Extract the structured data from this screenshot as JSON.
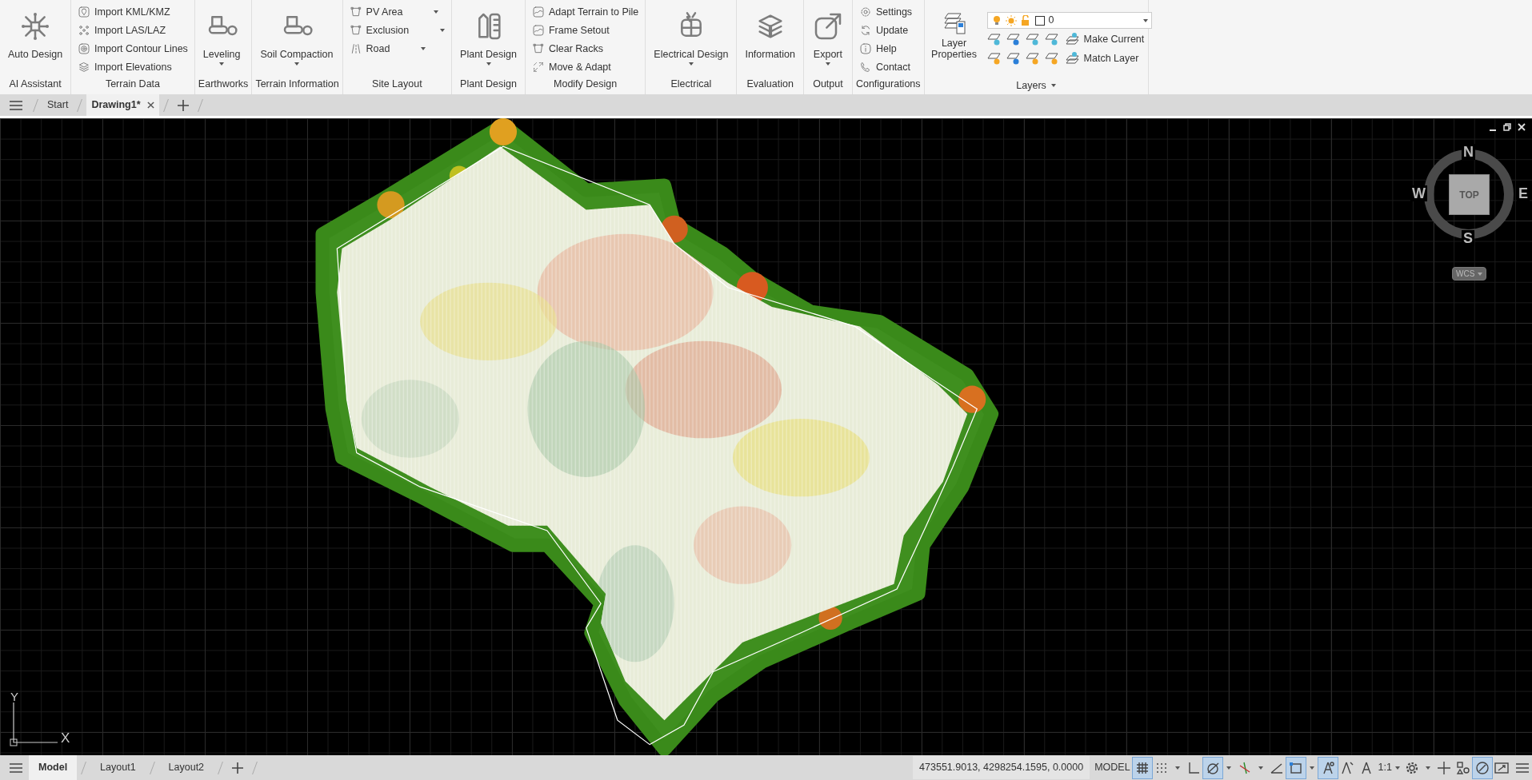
{
  "ribbon": {
    "panels": [
      {
        "label": "AI Assistant",
        "kind": "large",
        "items": [
          {
            "label": "Auto Design",
            "dropdown": false
          }
        ]
      },
      {
        "label": "Terrain Data",
        "kind": "list",
        "items": [
          {
            "label": "Import KML/KMZ",
            "dropdown": false
          },
          {
            "label": "Import LAS/LAZ",
            "dropdown": false
          },
          {
            "label": "Import Contour Lines",
            "dropdown": false
          },
          {
            "label": "Import Elevations",
            "dropdown": false
          }
        ]
      },
      {
        "label": "Earthworks",
        "kind": "large",
        "items": [
          {
            "label": "Leveling",
            "dropdown": true
          }
        ]
      },
      {
        "label": "Terrain Information",
        "kind": "large",
        "items": [
          {
            "label": "Soil Compaction",
            "dropdown": true
          }
        ]
      },
      {
        "label": "Site Layout",
        "kind": "list",
        "items": [
          {
            "label": "PV Area",
            "dropdown": true
          },
          {
            "label": "Exclusion",
            "dropdown": true
          },
          {
            "label": "Road",
            "dropdown": true
          }
        ]
      },
      {
        "label": "Plant Design",
        "kind": "large",
        "items": [
          {
            "label": "Plant Design",
            "dropdown": true
          }
        ]
      },
      {
        "label": "Modify Design",
        "kind": "list",
        "items": [
          {
            "label": "Adapt Terrain to Pile",
            "dropdown": false
          },
          {
            "label": "Frame Setout",
            "dropdown": false
          },
          {
            "label": "Clear Racks",
            "dropdown": false
          },
          {
            "label": "Move & Adapt",
            "dropdown": false
          }
        ]
      },
      {
        "label": "Electrical",
        "kind": "large",
        "items": [
          {
            "label": "Electrical Design",
            "dropdown": true
          }
        ]
      },
      {
        "label": "Evaluation",
        "kind": "large",
        "items": [
          {
            "label": "Information",
            "dropdown": false
          }
        ]
      },
      {
        "label": "Output",
        "kind": "large",
        "items": [
          {
            "label": "Export",
            "dropdown": true
          }
        ]
      },
      {
        "label": "Configurations",
        "kind": "list",
        "items": [
          {
            "label": "Settings",
            "dropdown": false
          },
          {
            "label": "Update",
            "dropdown": false
          },
          {
            "label": "Help",
            "dropdown": false
          },
          {
            "label": "Contact",
            "dropdown": false
          }
        ]
      }
    ],
    "layers": {
      "label": "Layers",
      "expandable": true,
      "properties_button": "Layer Properties",
      "current_layer": "0",
      "actions": [
        "Make Current",
        "Match Layer"
      ]
    }
  },
  "document_tabs": [
    {
      "label": "Start",
      "selected": false
    },
    {
      "label": "Drawing1*",
      "selected": true
    }
  ],
  "viewcube": {
    "north": "N",
    "south": "S",
    "west": "W",
    "east": "E",
    "face": "TOP",
    "coordinate_system": "WCS"
  },
  "ucs": {
    "y_label": "Y",
    "x_label": "X"
  },
  "layout_tabs": [
    {
      "label": "Model",
      "selected": true
    },
    {
      "label": "Layout1",
      "selected": false
    },
    {
      "label": "Layout2",
      "selected": false
    }
  ],
  "status_bar": {
    "coordinates": "473551.9013, 4298254.1595, 0.0000",
    "space": "MODEL",
    "scale": "1:1",
    "toggles": [
      {
        "on": true
      },
      {
        "on": false
      },
      {
        "on": false
      },
      {
        "on": true
      },
      {
        "on": false
      },
      {
        "on": false
      },
      {
        "on": true
      },
      {
        "on": true
      },
      {
        "on": false
      },
      {
        "on": false
      },
      {
        "on": false
      },
      {
        "on": false
      },
      {
        "on": false
      },
      {
        "on": true
      },
      {
        "on": false
      }
    ]
  }
}
